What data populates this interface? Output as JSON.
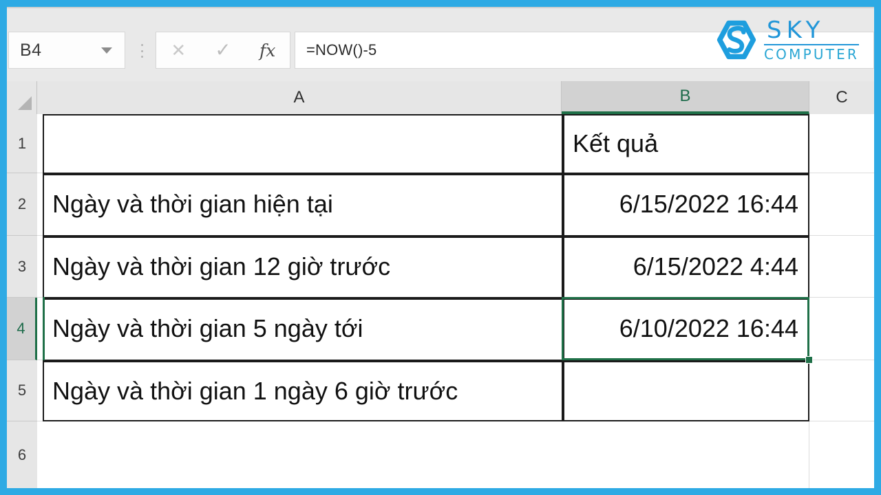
{
  "app": {
    "type": "spreadsheet",
    "accent_blue": "#2eaae4",
    "selection_green": "#1f7048"
  },
  "formula_bar": {
    "name_box_value": "B4",
    "name_box_dropdown_icon": "chevron-down-icon",
    "kebab_icon": "more-options-icon",
    "cancel_icon": "✕",
    "enter_icon": "✓",
    "function_icon": "fx",
    "formula_value": "=NOW()-5"
  },
  "logo": {
    "mark": "sky-hexagon-s-icon",
    "line1": "SKY",
    "line2": "COMPUTER",
    "color": "#2196d8"
  },
  "sheet": {
    "selected_cell": "B4",
    "column_headers": [
      {
        "label": "A",
        "selected": false
      },
      {
        "label": "B",
        "selected": true
      },
      {
        "label": "C",
        "selected": false
      }
    ],
    "row_headers": [
      {
        "label": "1",
        "selected": false
      },
      {
        "label": "2",
        "selected": false
      },
      {
        "label": "3",
        "selected": false
      },
      {
        "label": "4",
        "selected": true
      },
      {
        "label": "5",
        "selected": false
      },
      {
        "label": "6",
        "selected": false
      }
    ],
    "rows": [
      {
        "row": "1",
        "a": "",
        "b": "Kết quả",
        "b_align": "left"
      },
      {
        "row": "2",
        "a": "Ngày và thời gian hiện tại",
        "b": "6/15/2022 16:44",
        "b_align": "right"
      },
      {
        "row": "3",
        "a": "Ngày và thời gian 12 giờ trước",
        "b": "6/15/2022 4:44",
        "b_align": "right"
      },
      {
        "row": "4",
        "a": "Ngày và thời gian 5 ngày tới",
        "b": "6/10/2022 16:44",
        "b_align": "right"
      },
      {
        "row": "5",
        "a": "Ngày và thời gian 1 ngày 6 giờ trước",
        "b": "",
        "b_align": "right"
      },
      {
        "row": "6",
        "a": "",
        "b": "",
        "b_align": "right"
      }
    ]
  }
}
